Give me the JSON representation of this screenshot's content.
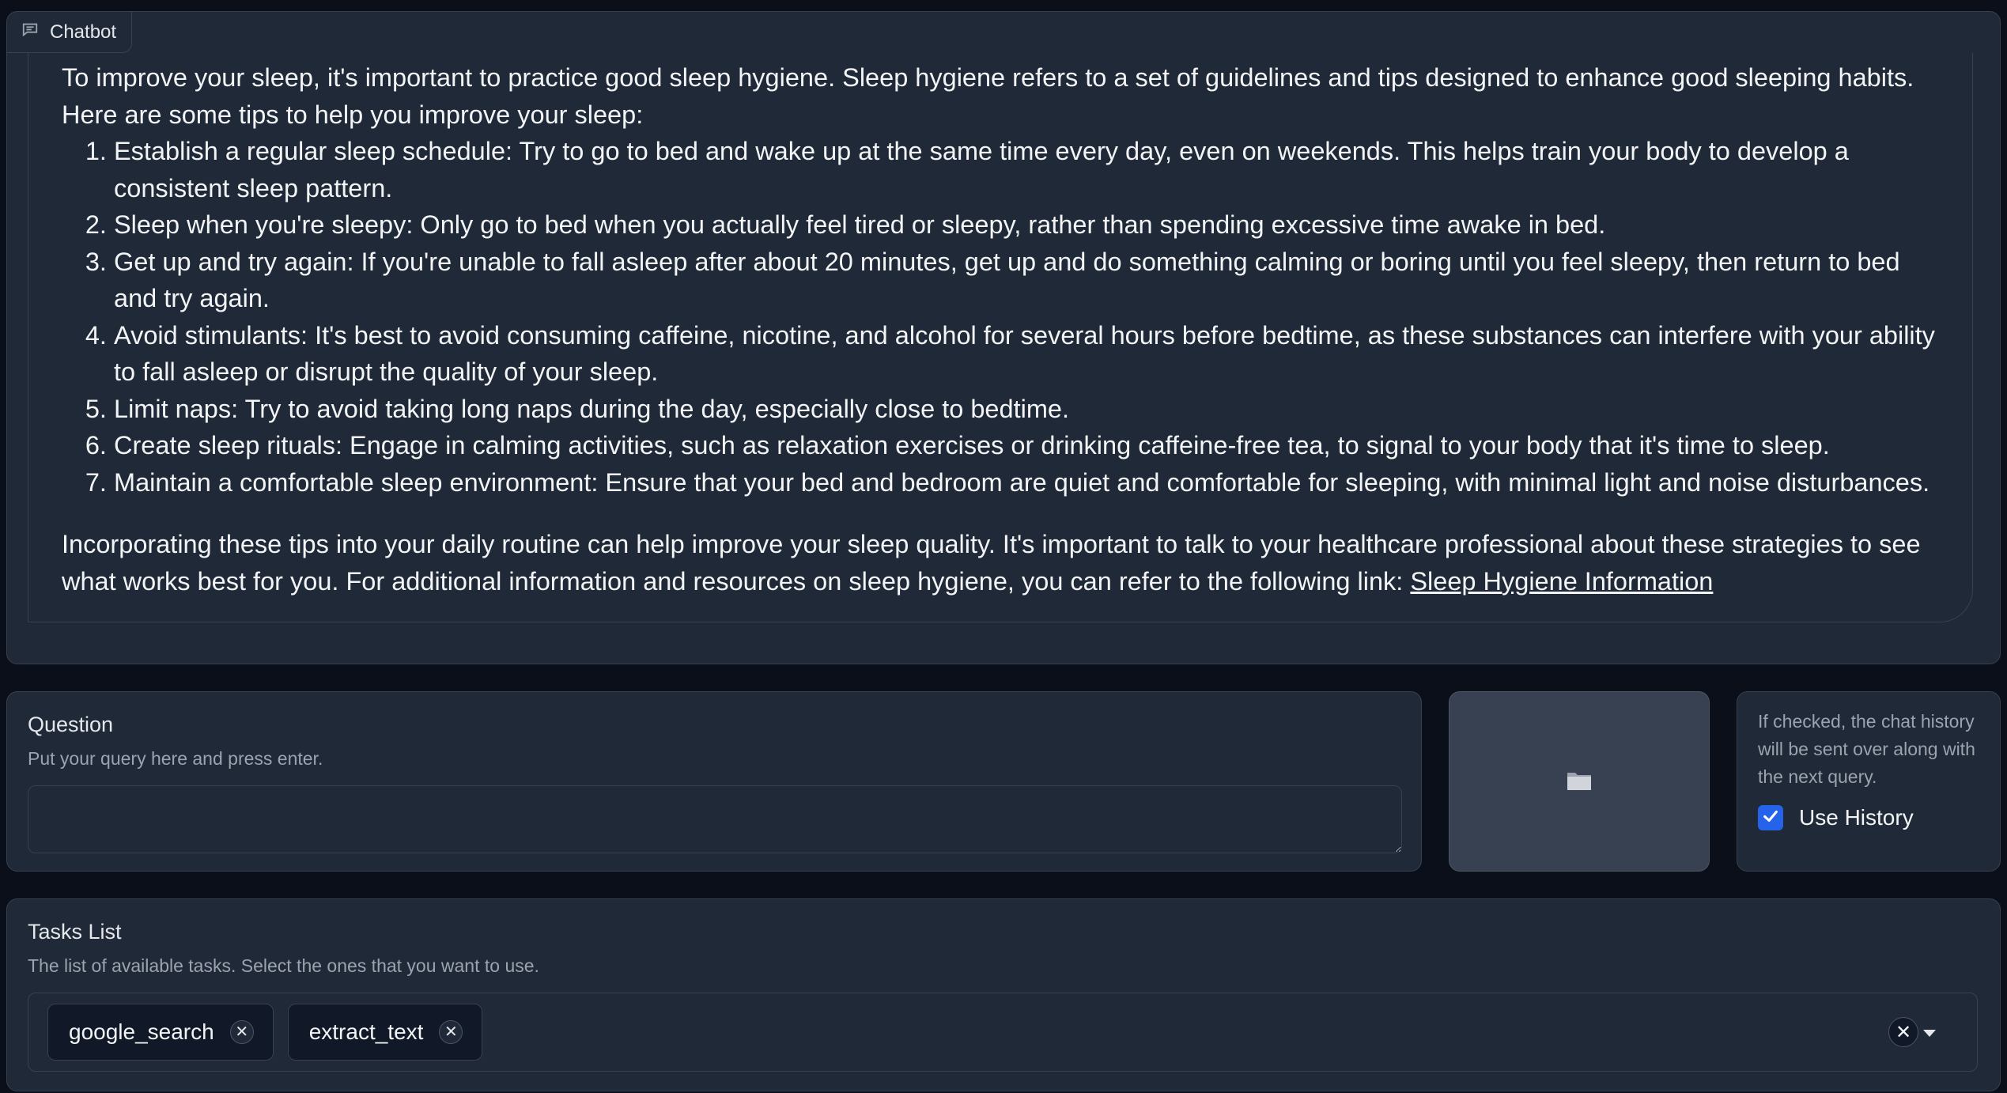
{
  "chatbot": {
    "tab_label": "Chatbot",
    "message": {
      "intro": "To improve your sleep, it's important to practice good sleep hygiene. Sleep hygiene refers to a set of guidelines and tips designed to enhance good sleeping habits. Here are some tips to help you improve your sleep:",
      "tips": [
        "Establish a regular sleep schedule: Try to go to bed and wake up at the same time every day, even on weekends. This helps train your body to develop a consistent sleep pattern.",
        "Sleep when you're sleepy: Only go to bed when you actually feel tired or sleepy, rather than spending excessive time awake in bed.",
        "Get up and try again: If you're unable to fall asleep after about 20 minutes, get up and do something calming or boring until you feel sleepy, then return to bed and try again.",
        "Avoid stimulants: It's best to avoid consuming caffeine, nicotine, and alcohol for several hours before bedtime, as these substances can interfere with your ability to fall asleep or disrupt the quality of your sleep.",
        "Limit naps: Try to avoid taking long naps during the day, especially close to bedtime.",
        "Create sleep rituals: Engage in calming activities, such as relaxation exercises or drinking caffeine-free tea, to signal to your body that it's time to sleep.",
        "Maintain a comfortable sleep environment: Ensure that your bed and bedroom are quiet and comfortable for sleeping, with minimal light and noise disturbances."
      ],
      "outro": "Incorporating these tips into your daily routine can help improve your sleep quality. It's important to talk to your healthcare professional about these strategies to see what works best for you. For additional information and resources on sleep hygiene, you can refer to the following link: ",
      "link_text": "Sleep Hygiene Information"
    }
  },
  "question": {
    "label": "Question",
    "info": "Put your query here and press enter.",
    "value": ""
  },
  "upload": {
    "icon": "folder-icon"
  },
  "history": {
    "info": "If checked, the chat history will be sent over along with the next query.",
    "checkbox_label": "Use History",
    "checked": true,
    "accent_color": "#2563eb"
  },
  "tasks": {
    "label": "Tasks List",
    "info": "The list of available tasks. Select the ones that you want to use.",
    "selected": [
      "google_search",
      "extract_text"
    ]
  }
}
